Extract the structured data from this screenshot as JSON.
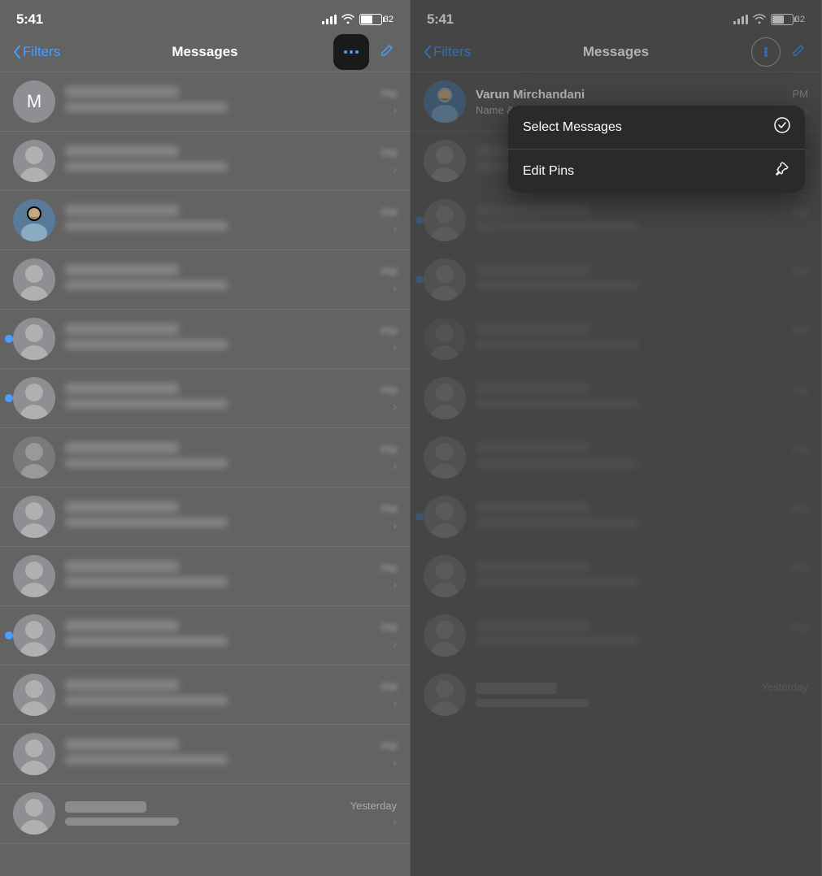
{
  "left_panel": {
    "status_bar": {
      "time": "5:41",
      "battery_level": "32"
    },
    "nav": {
      "back_label": "Filters",
      "title": "Messages",
      "more_btn_aria": "More options",
      "compose_aria": "Compose"
    },
    "messages": [
      {
        "id": "m1",
        "avatar_type": "letter",
        "letter": "M",
        "has_unread": false,
        "time": "PM",
        "show_chevron": true
      },
      {
        "id": "m2",
        "avatar_type": "person",
        "has_unread": false,
        "time": "PM",
        "show_chevron": true
      },
      {
        "id": "m3",
        "avatar_type": "photo",
        "has_unread": false,
        "time": "PM",
        "show_chevron": true
      },
      {
        "id": "m4",
        "avatar_type": "person",
        "has_unread": false,
        "time": "PM",
        "show_chevron": true
      },
      {
        "id": "m5",
        "avatar_type": "person",
        "has_unread": true,
        "time": "PM",
        "show_chevron": true
      },
      {
        "id": "m6",
        "avatar_type": "person",
        "has_unread": true,
        "time": "PM",
        "show_chevron": true
      },
      {
        "id": "m7",
        "avatar_type": "person_dark",
        "has_unread": false,
        "time": "PM",
        "show_chevron": true
      },
      {
        "id": "m8",
        "avatar_type": "person",
        "has_unread": false,
        "time": "PM",
        "show_chevron": true
      },
      {
        "id": "m9",
        "avatar_type": "person",
        "has_unread": false,
        "time": "PM",
        "show_chevron": true
      },
      {
        "id": "m10",
        "avatar_type": "person",
        "has_unread": true,
        "time": "PM",
        "show_chevron": true
      },
      {
        "id": "m11",
        "avatar_type": "person",
        "has_unread": false,
        "time": "PM",
        "show_chevron": true
      },
      {
        "id": "m12",
        "avatar_type": "person",
        "has_unread": false,
        "time": "PM",
        "show_chevron": true
      }
    ],
    "bottom_item": {
      "name": "VD-iOnsMC",
      "time": "Yesterday"
    }
  },
  "right_panel": {
    "status_bar": {
      "time": "5:41",
      "battery_level": "32"
    },
    "nav": {
      "back_label": "Filters",
      "title": "Messages",
      "more_btn_aria": "More options circle",
      "compose_aria": "Compose"
    },
    "profile_item": {
      "name": "Varun Mirchandani",
      "subtitle": "Name & Photo",
      "time": "PM",
      "show_chevron": true
    },
    "dropdown": {
      "select_messages_label": "Select Messages",
      "select_messages_icon": "✓",
      "edit_pins_label": "Edit Pins",
      "edit_pins_icon": "📌"
    },
    "messages": [
      {
        "id": "r1",
        "avatar_type": "person",
        "has_unread": false,
        "time": "PM",
        "show_chevron": true
      },
      {
        "id": "r2",
        "avatar_type": "person",
        "has_unread": true,
        "time": "PM",
        "show_chevron": true
      },
      {
        "id": "r3",
        "avatar_type": "person",
        "has_unread": true,
        "time": "PM",
        "show_chevron": true
      },
      {
        "id": "r4",
        "avatar_type": "person",
        "has_unread": false,
        "time": "PM",
        "show_chevron": true
      },
      {
        "id": "r5",
        "avatar_type": "person",
        "has_unread": false,
        "time": "PM",
        "show_chevron": true
      },
      {
        "id": "r6",
        "avatar_type": "person",
        "has_unread": false,
        "time": "PM",
        "show_chevron": true
      },
      {
        "id": "r7",
        "avatar_type": "person",
        "has_unread": true,
        "time": "PM",
        "show_chevron": true
      },
      {
        "id": "r8",
        "avatar_type": "person",
        "has_unread": false,
        "time": "PM",
        "show_chevron": true
      },
      {
        "id": "r9",
        "avatar_type": "person",
        "has_unread": false,
        "time": "PM",
        "show_chevron": true
      }
    ],
    "bottom_item": {
      "name": "VD-iOnsMC",
      "time": "Yesterday"
    }
  }
}
